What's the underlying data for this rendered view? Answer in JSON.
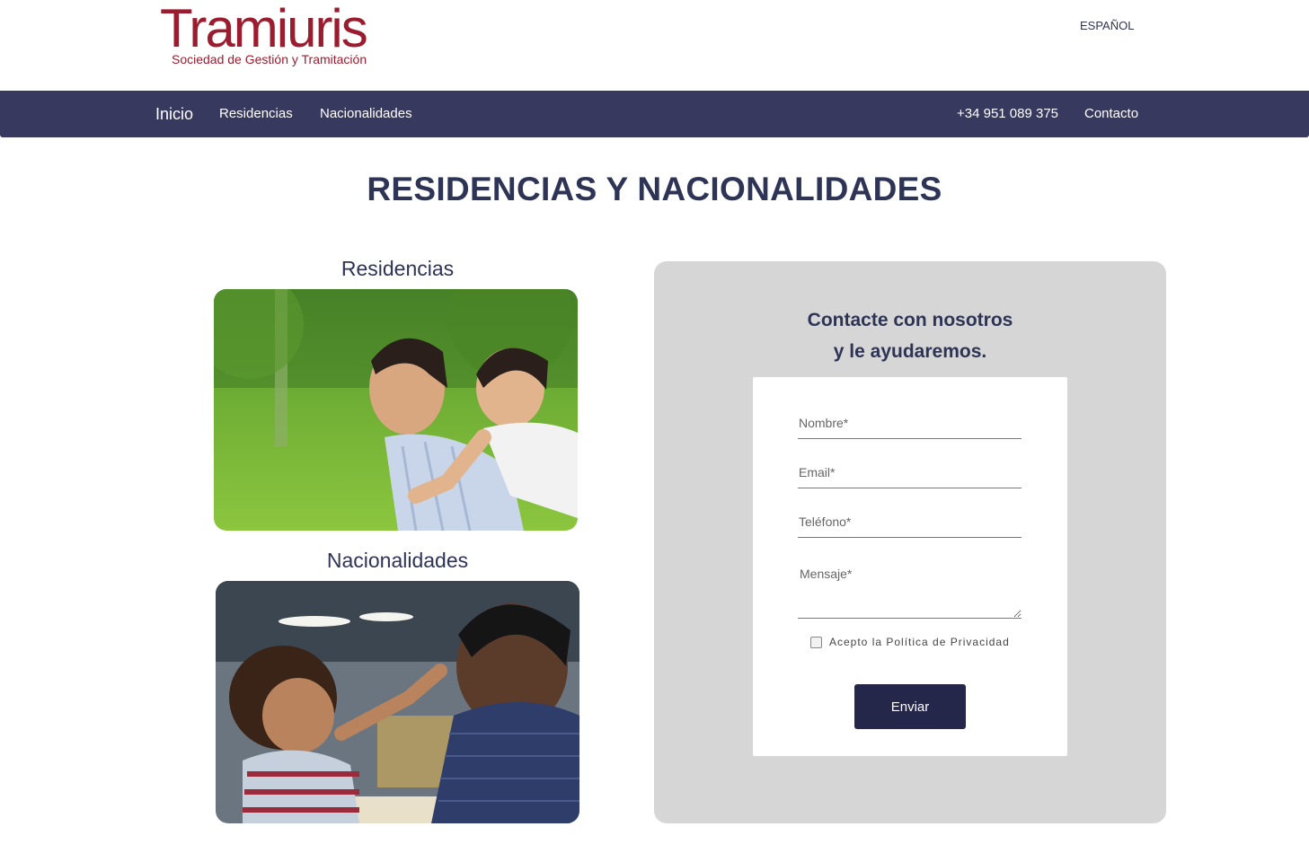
{
  "header": {
    "logo_name": "Tramiuris",
    "logo_tagline": "Sociedad de Gestión y Tramitación",
    "language": "ESPAÑOL"
  },
  "nav": {
    "home": "Inicio",
    "residencias": "Residencias",
    "nacionalidades": "Nacionalidades",
    "phone": "+34 951 089 375",
    "contacto": "Contacto"
  },
  "main": {
    "title": "RESIDENCIAS Y NACIONALIDADES",
    "cards": [
      {
        "title": "Residencias"
      },
      {
        "title": "Nacionalidades"
      }
    ]
  },
  "contact": {
    "heading_line1": "Contacte con nosotros",
    "heading_line2": "y le ayudaremos.",
    "name_placeholder": "Nombre*",
    "email_placeholder": "Email*",
    "phone_placeholder": "Teléfono*",
    "message_placeholder": "Mensaje*",
    "privacy_label": "Acepto la Política de Privacidad",
    "submit_label": "Enviar"
  },
  "colors": {
    "brand": "#9b1c2e",
    "nav_bg": "#373a5e",
    "title": "#2e3455",
    "panel_bg": "#d6d6d6",
    "button": "#24264a"
  },
  "icons": [
    "checkbox-icon"
  ]
}
